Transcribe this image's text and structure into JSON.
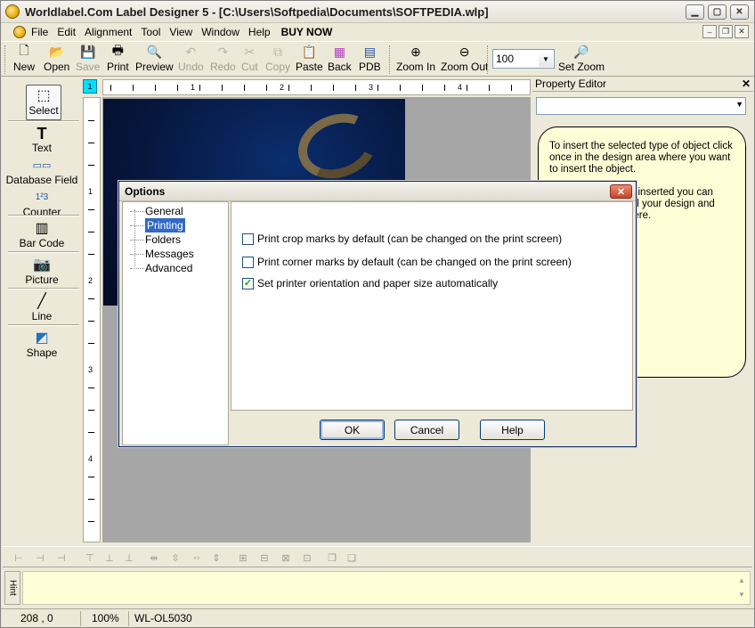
{
  "window": {
    "title": "Worldlabel.Com Label Designer 5  - [C:\\Users\\Softpedia\\Documents\\SOFTPEDIA.wlp]"
  },
  "menu": {
    "items": [
      "File",
      "Edit",
      "Alignment",
      "Tool",
      "View",
      "Window",
      "Help"
    ],
    "buy_now": "BUY NOW"
  },
  "toolbar": {
    "new": "New",
    "open": "Open",
    "save": "Save",
    "print": "Print",
    "preview": "Preview",
    "undo": "Undo",
    "redo": "Redo",
    "cut": "Cut",
    "copy": "Copy",
    "paste": "Paste",
    "back": "Back",
    "pdb": "PDB",
    "zoom_in": "Zoom In",
    "zoom_out": "Zoom Out",
    "zoom_value": "100",
    "set_zoom": "Set Zoom"
  },
  "left_tools": {
    "select": "Select",
    "text": "Text",
    "database_field": "Database Field",
    "counter": "Counter",
    "bar_code": "Bar Code",
    "picture": "Picture",
    "line": "Line",
    "shape": "Shape"
  },
  "ruler": {
    "corner": "1",
    "top_numbers": [
      "1",
      "2",
      "3",
      "4"
    ],
    "left_numbers": [
      "1",
      "2",
      "3",
      "4"
    ]
  },
  "property_editor": {
    "title": "Property Editor",
    "note_p1": "To insert the selected type of object click once in the design area where you want to insert the object.",
    "note_p2_a": "is inserted you can",
    "note_p2_b": "nd your design and",
    "note_p2_c": "here."
  },
  "hint": {
    "label": "Hint"
  },
  "status": {
    "coords": "208 , 0",
    "zoom": "100%",
    "label_code": "WL-OL5030"
  },
  "dialog": {
    "title": "Options",
    "tree": [
      "General",
      "Printing",
      "Folders",
      "Messages",
      "Advanced"
    ],
    "selected": "Printing",
    "options": [
      {
        "label": "Print crop marks by default (can be changed on the print screen)",
        "checked": false
      },
      {
        "label": "Print corner marks by default (can be changed on the print screen)",
        "checked": false
      },
      {
        "label": "Set printer orientation and paper size automatically",
        "checked": true
      }
    ],
    "ok": "OK",
    "cancel": "Cancel",
    "help": "Help"
  }
}
